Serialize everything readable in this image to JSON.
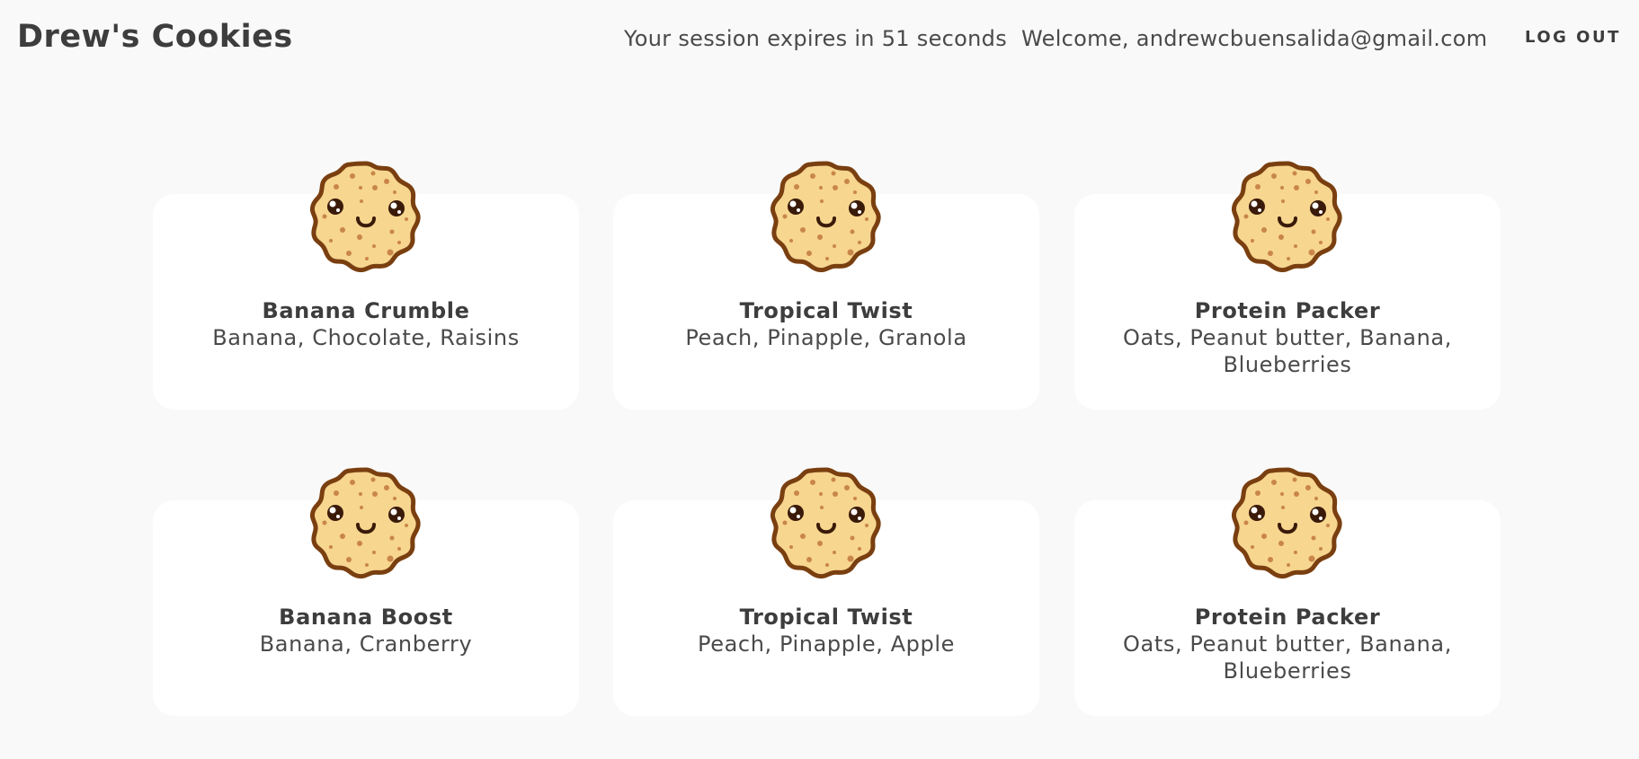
{
  "header": {
    "brand": "Drew's Cookies",
    "session_text": "Your session expires in 51 seconds",
    "welcome_text": "Welcome, andrewcbuensalida@gmail.com",
    "logout_label": "LOG OUT"
  },
  "cookies": [
    {
      "name": "Banana Crumble",
      "ingredients": "Banana, Chocolate, Raisins",
      "icon": "cookie-icon"
    },
    {
      "name": "Tropical Twist",
      "ingredients": "Peach, Pinapple, Granola",
      "icon": "cookie-icon"
    },
    {
      "name": "Protein Packer",
      "ingredients": "Oats, Peanut butter, Banana, Blueberries",
      "icon": "cookie-icon"
    },
    {
      "name": "Banana Boost",
      "ingredients": "Banana, Cranberry",
      "icon": "cookie-icon"
    },
    {
      "name": "Tropical Twist",
      "ingredients": "Peach, Pinapple, Apple",
      "icon": "cookie-icon"
    },
    {
      "name": "Protein Packer",
      "ingredients": "Oats, Peanut butter, Banana, Blueberries",
      "icon": "cookie-icon"
    }
  ],
  "colors": {
    "background": "#f9f9f9",
    "card": "#ffffff",
    "cookie_fill": "#f7d68f",
    "cookie_outline": "#7a3f10",
    "text": "#3d3d3d"
  }
}
